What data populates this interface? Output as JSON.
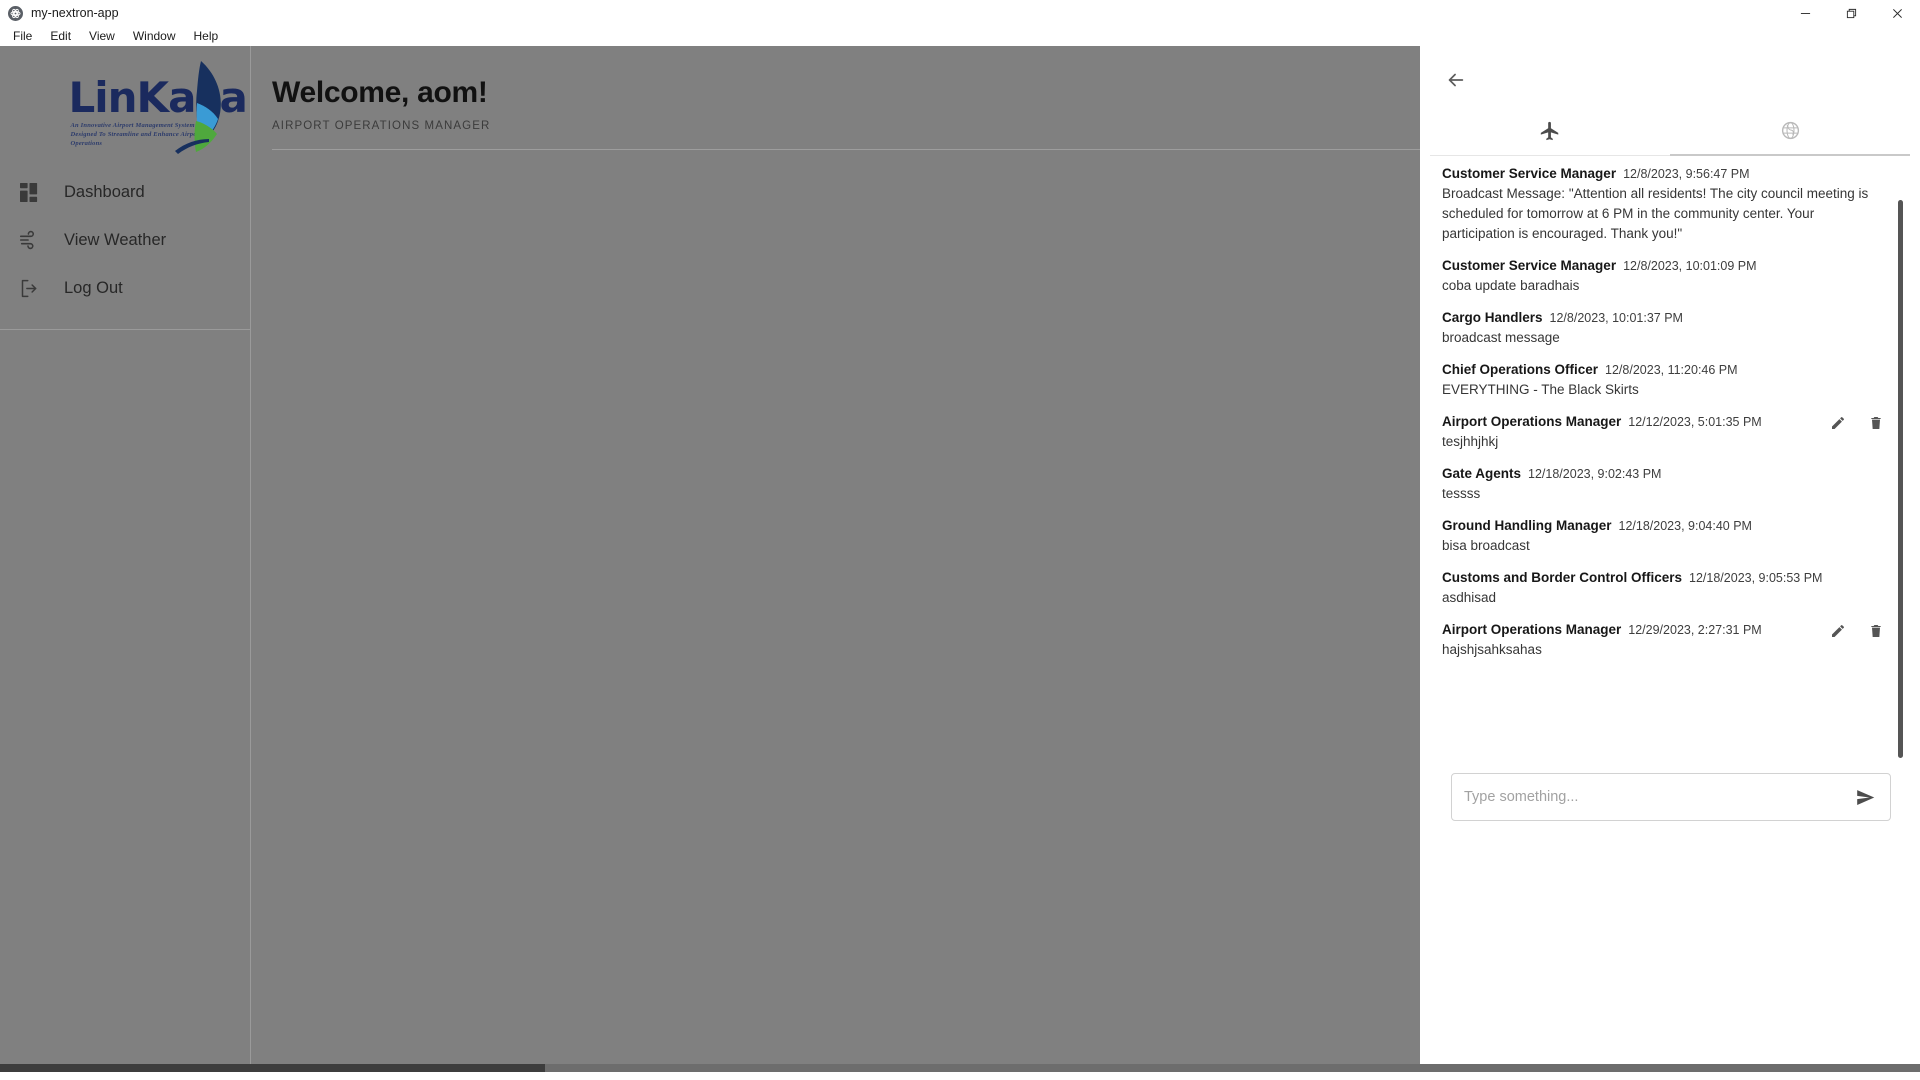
{
  "window": {
    "title": "my-nextron-app",
    "app_icon": "app-icon",
    "controls": [
      {
        "name": "minimize",
        "label": "Minimize"
      },
      {
        "name": "maximize",
        "label": "Restore"
      },
      {
        "name": "close",
        "label": "Close"
      }
    ]
  },
  "menubar": {
    "items": [
      "File",
      "Edit",
      "View",
      "Window",
      "Help"
    ]
  },
  "sidebar": {
    "logo": {
      "text": "LinKasa",
      "tagline_line1": "An Innovative Airport Management System",
      "tagline_line2": "Designed To Streamline and Enhance Airport Operations",
      "mark": "feather-logo-mark"
    },
    "items": [
      {
        "label": "Dashboard",
        "icon": "dashboard-grid-icon"
      },
      {
        "label": "View Weather",
        "icon": "wind-icon"
      },
      {
        "label": "Log Out",
        "icon": "logout-icon"
      }
    ]
  },
  "header": {
    "greeting": "Welcome, aom!",
    "role": "AIRPORT OPERATIONS MANAGER"
  },
  "drawer": {
    "back_icon": "arrow-left-icon",
    "tabs": [
      {
        "name": "flights",
        "icon": "airplane-icon",
        "active": false
      },
      {
        "name": "broadcast",
        "icon": "globe-icon",
        "active": true
      }
    ],
    "messages": [
      {
        "sender": "Customer Service Manager",
        "time": "12/8/2023, 9:56:47 PM",
        "body": "Broadcast Message: \"Attention all residents! The city council meeting is scheduled for tomorrow at 6 PM in the community center. Your participation is encouraged. Thank you!\"",
        "own": false
      },
      {
        "sender": "Customer Service Manager",
        "time": "12/8/2023, 10:01:09 PM",
        "body": "coba update baradhais",
        "own": false
      },
      {
        "sender": "Cargo Handlers",
        "time": "12/8/2023, 10:01:37 PM",
        "body": "broadcast message",
        "own": false
      },
      {
        "sender": "Chief Operations Officer",
        "time": "12/8/2023, 11:20:46 PM",
        "body": "EVERYTHING - The Black Skirts",
        "own": false
      },
      {
        "sender": "Airport Operations Manager",
        "time": "12/12/2023, 5:01:35 PM",
        "body": "tesjhhjhkj",
        "own": true
      },
      {
        "sender": "Gate Agents",
        "time": "12/18/2023, 9:02:43 PM",
        "body": "tessss",
        "own": false
      },
      {
        "sender": "Ground Handling Manager",
        "time": "12/18/2023, 9:04:40 PM",
        "body": "bisa broadcast",
        "own": false
      },
      {
        "sender": "Customs and Border Control Officers",
        "time": "12/18/2023, 9:05:53 PM",
        "body": "asdhisad",
        "own": false
      },
      {
        "sender": "Airport Operations Manager",
        "time": "12/29/2023, 2:27:31 PM",
        "body": "hajshjsahksahas",
        "own": true
      }
    ],
    "message_actions": {
      "edit_icon": "pencil-icon",
      "delete_icon": "trash-icon"
    },
    "composer": {
      "placeholder": "Type something...",
      "value": "",
      "send_icon": "send-icon"
    }
  },
  "colors": {
    "backdrop": "#808080",
    "logo_navy": "#1b2a5e",
    "loading_bar": "#b6476a",
    "scrollbar": "#555555"
  }
}
